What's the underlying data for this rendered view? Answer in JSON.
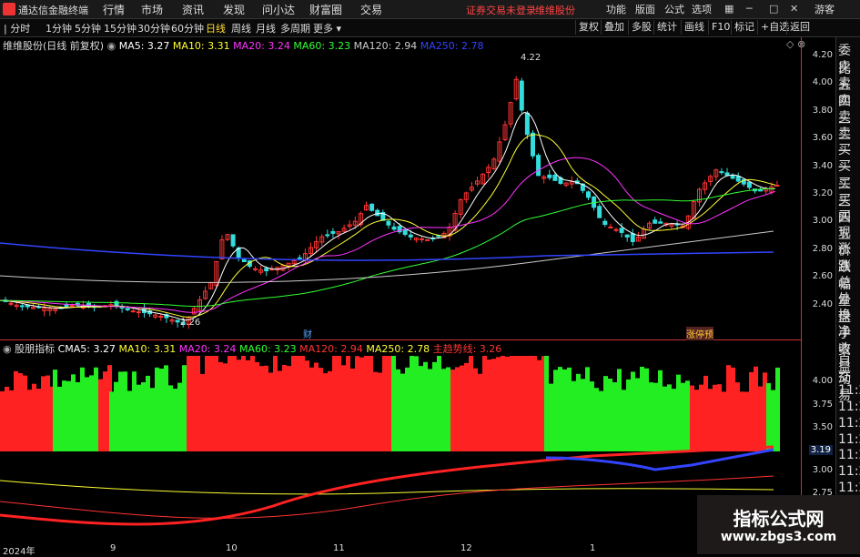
{
  "app": {
    "name": "通达信金融终端"
  },
  "menu": [
    "行情",
    "市场",
    "资讯",
    "发现",
    "问小达",
    "财富圈",
    "交易"
  ],
  "status": {
    "warning": "证券交易未登录",
    "stock_name": "维维股份"
  },
  "topright": [
    "功能",
    "版面",
    "公式",
    "选项"
  ],
  "guest": "游客",
  "timeframes": [
    "分时",
    "1分钟",
    "5分钟",
    "15分钟",
    "30分钟",
    "60分钟",
    "日线",
    "周线",
    "月线",
    "多周期",
    "更多"
  ],
  "active_timeframe": "日线",
  "toolbar_buttons": [
    "复权",
    "叠加",
    "多股",
    "统计",
    "画线",
    "F10",
    "标记",
    "+自选",
    "返回"
  ],
  "main_chart": {
    "title": "维维股份(日线 前复权)",
    "ma": [
      {
        "label": "MA5: 3.27",
        "color": "#ffffff"
      },
      {
        "label": "MA10: 3.31",
        "color": "#ffff33"
      },
      {
        "label": "MA20: 3.24",
        "color": "#ff33ff"
      },
      {
        "label": "MA60: 3.23",
        "color": "#33ff33"
      },
      {
        "label": "MA120: 2.94",
        "color": "#cccccc"
      },
      {
        "label": "MA250: 2.78",
        "color": "#3344ff"
      }
    ],
    "high_label": "4.22",
    "low_label": "2.26",
    "marker_cai": "财",
    "marker_zt": "涨停预",
    "y_ticks": [
      "4.20",
      "4.00",
      "3.80",
      "3.60",
      "3.40",
      "3.20",
      "3.00",
      "2.80",
      "2.60",
      "2.40"
    ]
  },
  "sub_chart": {
    "title": "股朋指标",
    "items": [
      {
        "label": "CMA5: 3.27",
        "color": "#ffffff"
      },
      {
        "label": "MA10: 3.31",
        "color": "#ffff33"
      },
      {
        "label": "MA20: 3.24",
        "color": "#ff33ff"
      },
      {
        "label": "MA60: 3.23",
        "color": "#33ff33"
      },
      {
        "label": "MA120: 2.94",
        "color": "#ff3333"
      },
      {
        "label": "MA250: 2.78",
        "color": "#ffff33"
      },
      {
        "label": "主趋势线: 3.26",
        "color": "#ff3333"
      }
    ],
    "y_ticks": [
      "4.00",
      "3.75",
      "3.50",
      "3.25",
      "3.00",
      "2.75"
    ],
    "current_value": "3.19"
  },
  "x_labels": [
    "2024年",
    "9",
    "10",
    "11",
    "12",
    "1"
  ],
  "right_panel": [
    "委比",
    "卖五",
    "卖四",
    "卖三",
    "卖二",
    "卖一",
    "买一",
    "买二",
    "买三",
    "买四",
    "买五",
    "现价",
    "涨跌",
    "涨幅",
    "总量",
    "外盘",
    "换手",
    "净资",
    "收益"
  ],
  "right_panel_lower": [
    "自动",
    "交易",
    "11:29",
    "11:29",
    "11:29",
    "11:29",
    "11:29",
    "11:29",
    "11:29",
    "11:29",
    "11:29",
    "11:29"
  ],
  "watermark": {
    "line1": "指标公式网",
    "line2": "www.zbgs3.com"
  }
}
